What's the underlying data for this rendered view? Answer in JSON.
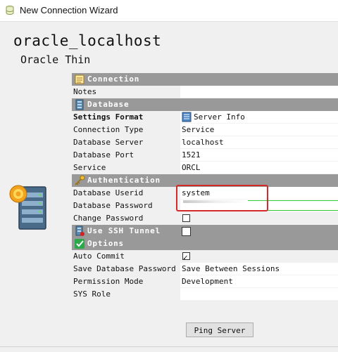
{
  "window": {
    "title": "New Connection Wizard"
  },
  "connection": {
    "name": "oracle_localhost",
    "driver": "Oracle Thin"
  },
  "sections": {
    "connection": "Connection",
    "database": "Database",
    "authentication": "Authentication",
    "ssh": "Use SSH Tunnel",
    "options": "Options"
  },
  "rows": {
    "notes": {
      "label": "Notes",
      "value": ""
    },
    "settings_format": {
      "label": "Settings Format",
      "value": "Server Info"
    },
    "connection_type": {
      "label": "Connection Type",
      "value": "Service"
    },
    "database_server": {
      "label": "Database Server",
      "value": "localhost"
    },
    "database_port": {
      "label": "Database Port",
      "value": "1521"
    },
    "service": {
      "label": "Service",
      "value": "ORCL"
    },
    "database_userid": {
      "label": "Database Userid",
      "value": "system"
    },
    "database_password": {
      "label": "Database Password",
      "value": ""
    },
    "change_password": {
      "label": "Change Password",
      "checked": false
    },
    "auto_commit": {
      "label": "Auto Commit",
      "checked": true
    },
    "save_database_password": {
      "label": "Save Database Password",
      "value": "Save Between Sessions"
    },
    "permission_mode": {
      "label": "Permission Mode",
      "value": "Development"
    },
    "sys_role": {
      "label": "SYS Role",
      "value": ""
    }
  },
  "buttons": {
    "ping_server": "Ping Server"
  },
  "colors": {
    "section_header": "#999999",
    "highlight": "#d62a2a",
    "annotation_line": "#32c832"
  }
}
